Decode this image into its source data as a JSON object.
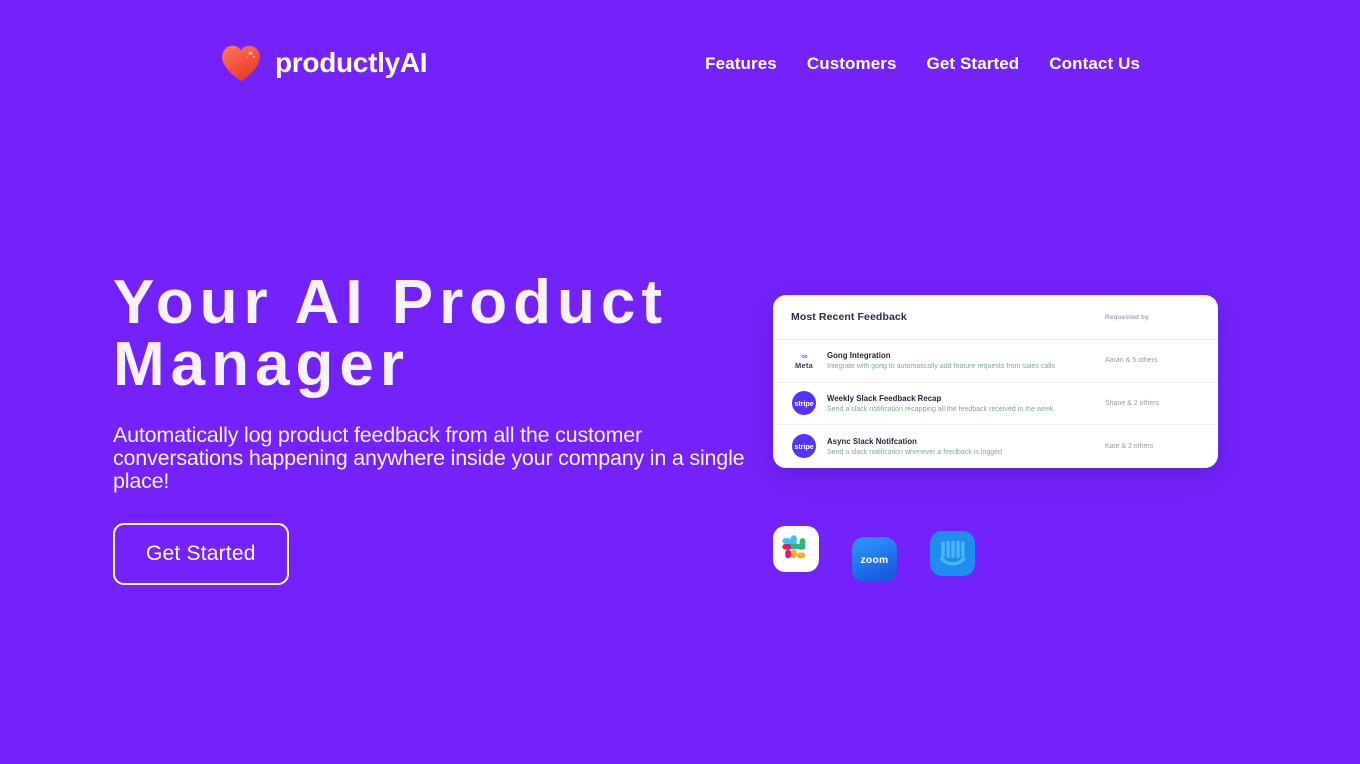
{
  "theme": {
    "background": "#7322FB",
    "card_background": "#FFFFFF",
    "text_on_purple": "#FFFFFF",
    "heart_color": "#F4533E",
    "stripe_blue": "#5433FF",
    "zoom_blue": "#2D8CFF",
    "intercom_blue": "#1F8DED"
  },
  "header": {
    "brand_name": "productlyAI",
    "logo_icon": "heart-icon",
    "nav": [
      {
        "label": "Features"
      },
      {
        "label": "Customers"
      },
      {
        "label": "Get Started"
      },
      {
        "label": "Contact Us"
      }
    ]
  },
  "hero": {
    "headline": "Your AI Product Manager",
    "subheadline": "Automatically log product feedback from all the customer conversations happening anywhere inside your company in a single place!",
    "cta_label": "Get Started"
  },
  "feedback_card": {
    "title": "Most Recent Feedback",
    "column_header_right": "Requested by",
    "rows": [
      {
        "logo": "meta-logo",
        "logo_text": "Meta",
        "title": "Gong Integration",
        "description": "Integrate with gong to automatically add feature requests from sales calls",
        "requested_by": "Aaran & 5 others"
      },
      {
        "logo": "stripe-logo",
        "logo_text": "stripe",
        "title": "Weekly Slack Feedback Recap",
        "description": "Send a slack notification recapping all the feedback received in the week",
        "requested_by": "Shane & 2 others"
      },
      {
        "logo": "stripe-logo",
        "logo_text": "stripe",
        "title": "Async Slack Notifcation",
        "description": "Send a slack notification whenever a feedback is logged",
        "requested_by": "Kate & 2 others"
      }
    ]
  },
  "integrations": [
    {
      "name": "slack-icon",
      "label": "Slack"
    },
    {
      "name": "zoom-icon",
      "label": "zoom"
    },
    {
      "name": "intercom-icon",
      "label": "Intercom"
    }
  ]
}
